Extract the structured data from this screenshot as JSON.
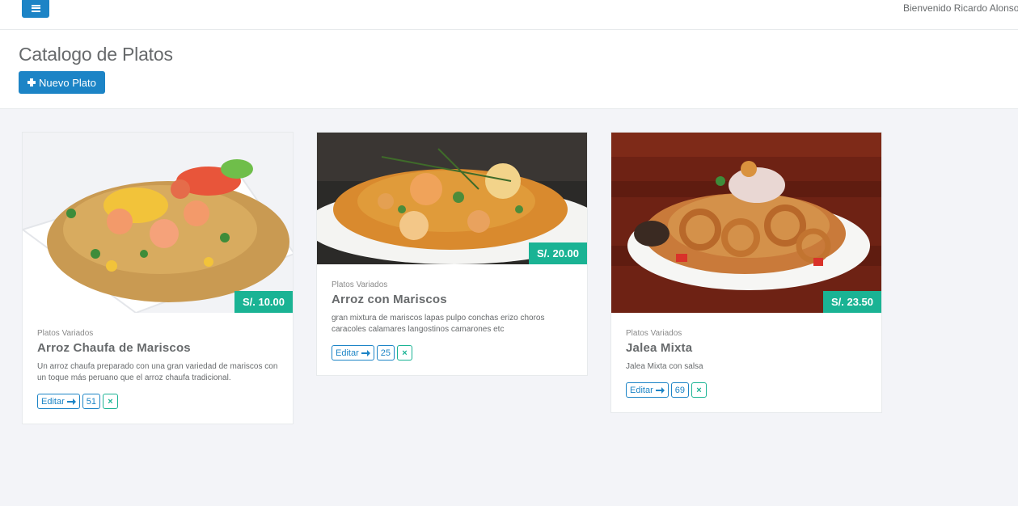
{
  "topbar": {
    "menu_icon": "bars-icon",
    "welcome": "Bienvenido Ricardo Alonso"
  },
  "header": {
    "title": "Catalogo de Platos",
    "new_button": "Nuevo Plato"
  },
  "dishes": [
    {
      "price": "S/. 10.00",
      "category": "Platos Variados",
      "name": "Arroz Chaufa de Mariscos",
      "description": "Un arroz chaufa preparado con una gran variedad de mariscos con un toque más peruano que el arroz chaufa tradicional.",
      "edit_label": "Editar",
      "count": "51",
      "delete_icon": "×"
    },
    {
      "price": "S/. 20.00",
      "category": "Platos Variados",
      "name": "Arroz con Mariscos",
      "description": "gran mixtura de mariscos lapas pulpo conchas erizo choros caracoles calamares langostinos camarones etc",
      "edit_label": "Editar",
      "count": "25",
      "delete_icon": "×"
    },
    {
      "price": "S/. 23.50",
      "category": "Platos Variados",
      "name": "Jalea Mixta",
      "description": "Jalea Mixta con salsa",
      "edit_label": "Editar",
      "count": "69",
      "delete_icon": "×"
    }
  ],
  "colors": {
    "primary": "#1c84c6",
    "success": "#1ab394",
    "background": "#f3f4f8"
  }
}
